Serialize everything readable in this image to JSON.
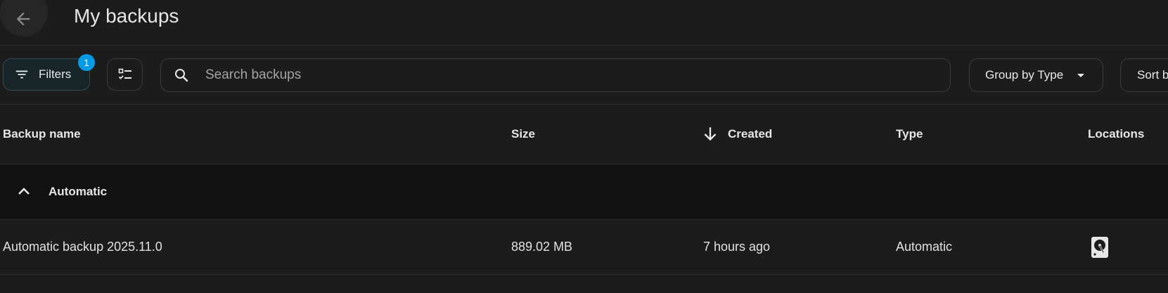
{
  "header": {
    "title": "My backups",
    "back_icon": "arrow-left-icon"
  },
  "toolbar": {
    "filters_label": "Filters",
    "filters_badge": "1",
    "search_placeholder": "Search backups",
    "search_value": "",
    "group_label": "Group by Type",
    "sort_label": "Sort by"
  },
  "table": {
    "columns": {
      "name": "Backup name",
      "size": "Size",
      "created": "Created",
      "type": "Type",
      "locations": "Locations"
    },
    "sort": {
      "column": "created",
      "direction": "descending"
    },
    "groups": [
      {
        "title": "Automatic",
        "expanded": true,
        "rows": [
          {
            "name": "Automatic backup 2025.11.0",
            "size": "889.02 MB",
            "created": "7 hours ago",
            "type": "Automatic",
            "location_icon": "harddisk-icon"
          }
        ]
      }
    ]
  },
  "colors": {
    "background": "#1c1c1c",
    "group_row_background": "#111111",
    "badge": "#039be5",
    "filter_active_background": "#172428",
    "text": "#e1e1e1"
  }
}
